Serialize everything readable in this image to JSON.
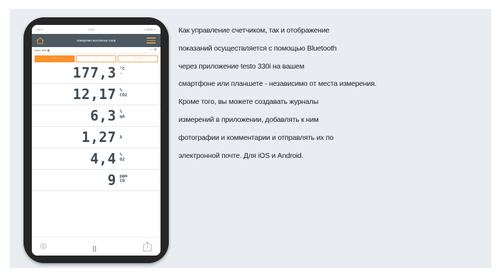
{
  "app": {
    "title": "Измерение выхлопных газов",
    "status_left": "•••• ᯤ",
    "status_time": "9:41",
    "status_right": "⁎ 100% ▭",
    "device": "testo 330i ◧",
    "device_right": "— ⚙"
  },
  "tabs": [
    "—",
    "—",
    "— —"
  ],
  "readings": [
    {
      "value": "177,3",
      "unit": [
        "°C",
        "·"
      ]
    },
    {
      "value": "12,17",
      "unit": [
        "%",
        "CO2"
      ]
    },
    {
      "value": "6,3",
      "unit": [
        "%",
        "qA"
      ]
    },
    {
      "value": "1,27",
      "unit": [
        "λ",
        ""
      ]
    },
    {
      "value": "4,4",
      "unit": [
        "%",
        "O2"
      ]
    },
    {
      "value": "9",
      "unit": [
        "ppm",
        "CO"
      ]
    }
  ],
  "description": [
    "Как управление счетчиком, так и отображение",
    "показаний осуществляется с помощью Bluetooth",
    "через приложение testo 330i на вашем",
    "смартфоне или планшете - независимо от места измерения.",
    "Кроме того, вы можете создавать журналы",
    "измерений в приложении, добавлять к ним",
    "фотографии и комментарии и отправлять их по",
    "электронной почте. Для iOS и Android."
  ],
  "colors": {
    "accent": "#f7932e",
    "titlebar": "#4e5962",
    "value_text": "#3d4a55",
    "panel_bg": "#e9edf1"
  }
}
